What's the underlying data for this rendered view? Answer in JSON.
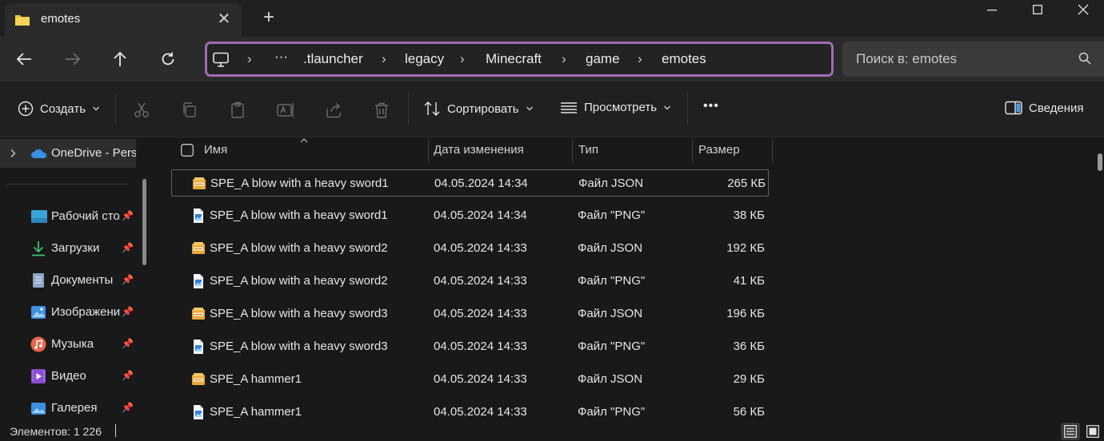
{
  "window": {
    "tab_title": "emotes",
    "tab_close": "✕",
    "new_tab": "+"
  },
  "nav": {
    "breadcrumbs": [
      ".tlauncher",
      "legacy",
      "Minecraft",
      "game",
      "emotes"
    ],
    "overflow": "···",
    "search_placeholder": "Поиск в: emotes"
  },
  "commands": {
    "create": "Создать",
    "sort": "Сортировать",
    "view": "Просмотреть",
    "more": "•••",
    "details": "Сведения"
  },
  "sidebar": {
    "onedrive": "OneDrive - Personal",
    "items": [
      {
        "label": "Рабочий стол",
        "icon": "desktop-icon"
      },
      {
        "label": "Загрузки",
        "icon": "download-icon"
      },
      {
        "label": "Документы",
        "icon": "document-icon"
      },
      {
        "label": "Изображения",
        "icon": "image-icon"
      },
      {
        "label": "Музыка",
        "icon": "music-icon"
      },
      {
        "label": "Видео",
        "icon": "video-icon"
      },
      {
        "label": "Галерея",
        "icon": "gallery-icon"
      }
    ]
  },
  "columns": {
    "name": "Имя",
    "date": "Дата изменения",
    "type": "Тип",
    "size": "Размер"
  },
  "files": [
    {
      "name": "SPE_A blow with a heavy sword1",
      "date": "04.05.2024 14:34",
      "type": "Файл JSON",
      "size": "265 КБ",
      "kind": "json"
    },
    {
      "name": "SPE_A blow with a heavy sword1",
      "date": "04.05.2024 14:34",
      "type": "Файл \"PNG\"",
      "size": "38 КБ",
      "kind": "png"
    },
    {
      "name": "SPE_A blow with a heavy sword2",
      "date": "04.05.2024 14:33",
      "type": "Файл JSON",
      "size": "192 КБ",
      "kind": "json"
    },
    {
      "name": "SPE_A blow with a heavy sword2",
      "date": "04.05.2024 14:33",
      "type": "Файл \"PNG\"",
      "size": "41 КБ",
      "kind": "png"
    },
    {
      "name": "SPE_A blow with a heavy sword3",
      "date": "04.05.2024 14:33",
      "type": "Файл JSON",
      "size": "196 КБ",
      "kind": "json"
    },
    {
      "name": "SPE_A blow with a heavy sword3",
      "date": "04.05.2024 14:33",
      "type": "Файл \"PNG\"",
      "size": "36 КБ",
      "kind": "png"
    },
    {
      "name": "SPE_A hammer1",
      "date": "04.05.2024 14:33",
      "type": "Файл JSON",
      "size": "29 КБ",
      "kind": "json"
    },
    {
      "name": "SPE_A hammer1",
      "date": "04.05.2024 14:33",
      "type": "Файл \"PNG\"",
      "size": "56 КБ",
      "kind": "png"
    }
  ],
  "status": {
    "items_count": "Элементов: 1 226"
  },
  "colors": {
    "address_border": "#a26bb5",
    "folder_yellow": "#f3c13a",
    "accent_blue": "#4a9fe0"
  }
}
